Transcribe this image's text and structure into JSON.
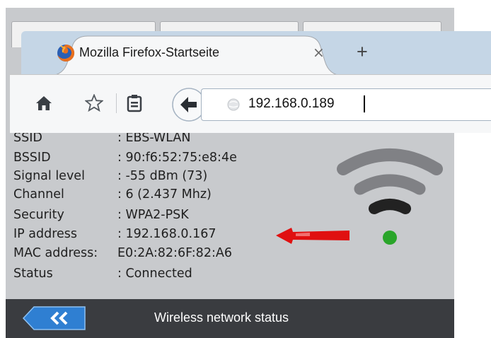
{
  "device": {
    "info_rows": [
      {
        "label": "SSID",
        "value": ": EBS-WLAN"
      },
      {
        "label": "BSSID",
        "value": ": 90:f6:52:75:e8:4e"
      },
      {
        "label": "Signal level",
        "value": ": -55 dBm (73)"
      },
      {
        "label": "Channel",
        "value": ": 6 (2.437 Mhz)"
      },
      {
        "label": "Security",
        "value": ": WPA2-PSK"
      },
      {
        "label": "IP address",
        "value": ": 192.168.0.167"
      },
      {
        "label": "MAC address:",
        "value": "E0:2A:82:6F:82:A6"
      },
      {
        "label": "Status",
        "value": ": Connected"
      }
    ],
    "footer_title": "Wireless network status",
    "back_icon": "double-chevron-left-icon",
    "wifi_icon": "wifi-signal-icon",
    "status_color": "#2aa52a",
    "arrow_color": "#e01010"
  },
  "browser": {
    "tab_title": "Mozilla Firefox-Startseite",
    "close_symbol": "×",
    "new_tab_symbol": "+",
    "url": "192.168.0.189",
    "icons": [
      "firefox-logo-icon",
      "home-icon",
      "bookmark-star-icon",
      "reading-list-icon",
      "back-arrow-icon",
      "globe-icon"
    ]
  }
}
